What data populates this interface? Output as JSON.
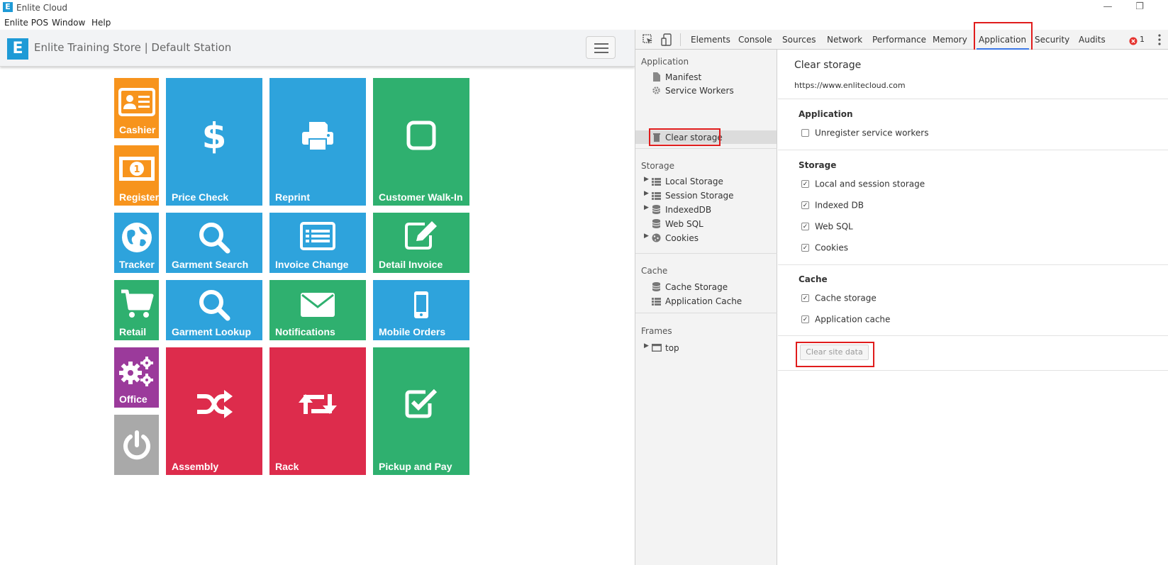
{
  "window": {
    "logo_letter": "E",
    "title": "Enlite Cloud",
    "minimize": "—",
    "restore": "❐"
  },
  "menu": [
    "Enlite POS",
    "Window",
    "Help"
  ],
  "pos": {
    "logo_letter": "E",
    "title": "Enlite Training Store | Default Station",
    "tiles": {
      "cashier": "Cashier",
      "register": "Register",
      "price_check": "Price Check",
      "reprint": "Reprint",
      "customer_walk_in": "Customer Walk-In",
      "tracker": "Tracker",
      "garment_search": "Garment Search",
      "invoice_change": "Invoice Change",
      "detail_invoice": "Detail Invoice",
      "retail": "Retail",
      "garment_lookup": "Garment Lookup",
      "notifications": "Notifications",
      "mobile_orders": "Mobile Orders",
      "office": "Office",
      "assembly": "Assembly",
      "rack": "Rack",
      "pickup_and_pay": "Pickup and Pay",
      "power": ""
    },
    "colors": {
      "orange": "#f7941d",
      "blue": "#2ea3dc",
      "green": "#2fb06f",
      "purple": "#9b3a9b",
      "red": "#dd2c4c",
      "gray": "#a9a9a9"
    }
  },
  "devtools": {
    "tabs": [
      "Elements",
      "Console",
      "Sources",
      "Network",
      "Performance",
      "Memory",
      "Application",
      "Security",
      "Audits"
    ],
    "active_tab": "Application",
    "error_count": "1",
    "sidebar": {
      "application_header": "Application",
      "application_items": [
        "Manifest",
        "Service Workers",
        "Clear storage"
      ],
      "storage_header": "Storage",
      "storage_items": [
        "Local Storage",
        "Session Storage",
        "IndexedDB",
        "Web SQL",
        "Cookies"
      ],
      "cache_header": "Cache",
      "cache_items": [
        "Cache Storage",
        "Application Cache"
      ],
      "frames_header": "Frames",
      "frames_items": [
        "top"
      ]
    },
    "main": {
      "title": "Clear storage",
      "origin": "https://www.enlitecloud.com",
      "application_header": "Application",
      "unregister_label": "Unregister service workers",
      "unregister_checked": false,
      "storage_header": "Storage",
      "storage_options": [
        {
          "label": "Local and session storage",
          "checked": true
        },
        {
          "label": "Indexed DB",
          "checked": true
        },
        {
          "label": "Web SQL",
          "checked": true
        },
        {
          "label": "Cookies",
          "checked": true
        }
      ],
      "cache_header": "Cache",
      "cache_options": [
        {
          "label": "Cache storage",
          "checked": true
        },
        {
          "label": "Application cache",
          "checked": true
        }
      ],
      "clear_button": "Clear site data"
    },
    "highlight_color": "#e01c1c",
    "accent": "#3b78e7"
  }
}
